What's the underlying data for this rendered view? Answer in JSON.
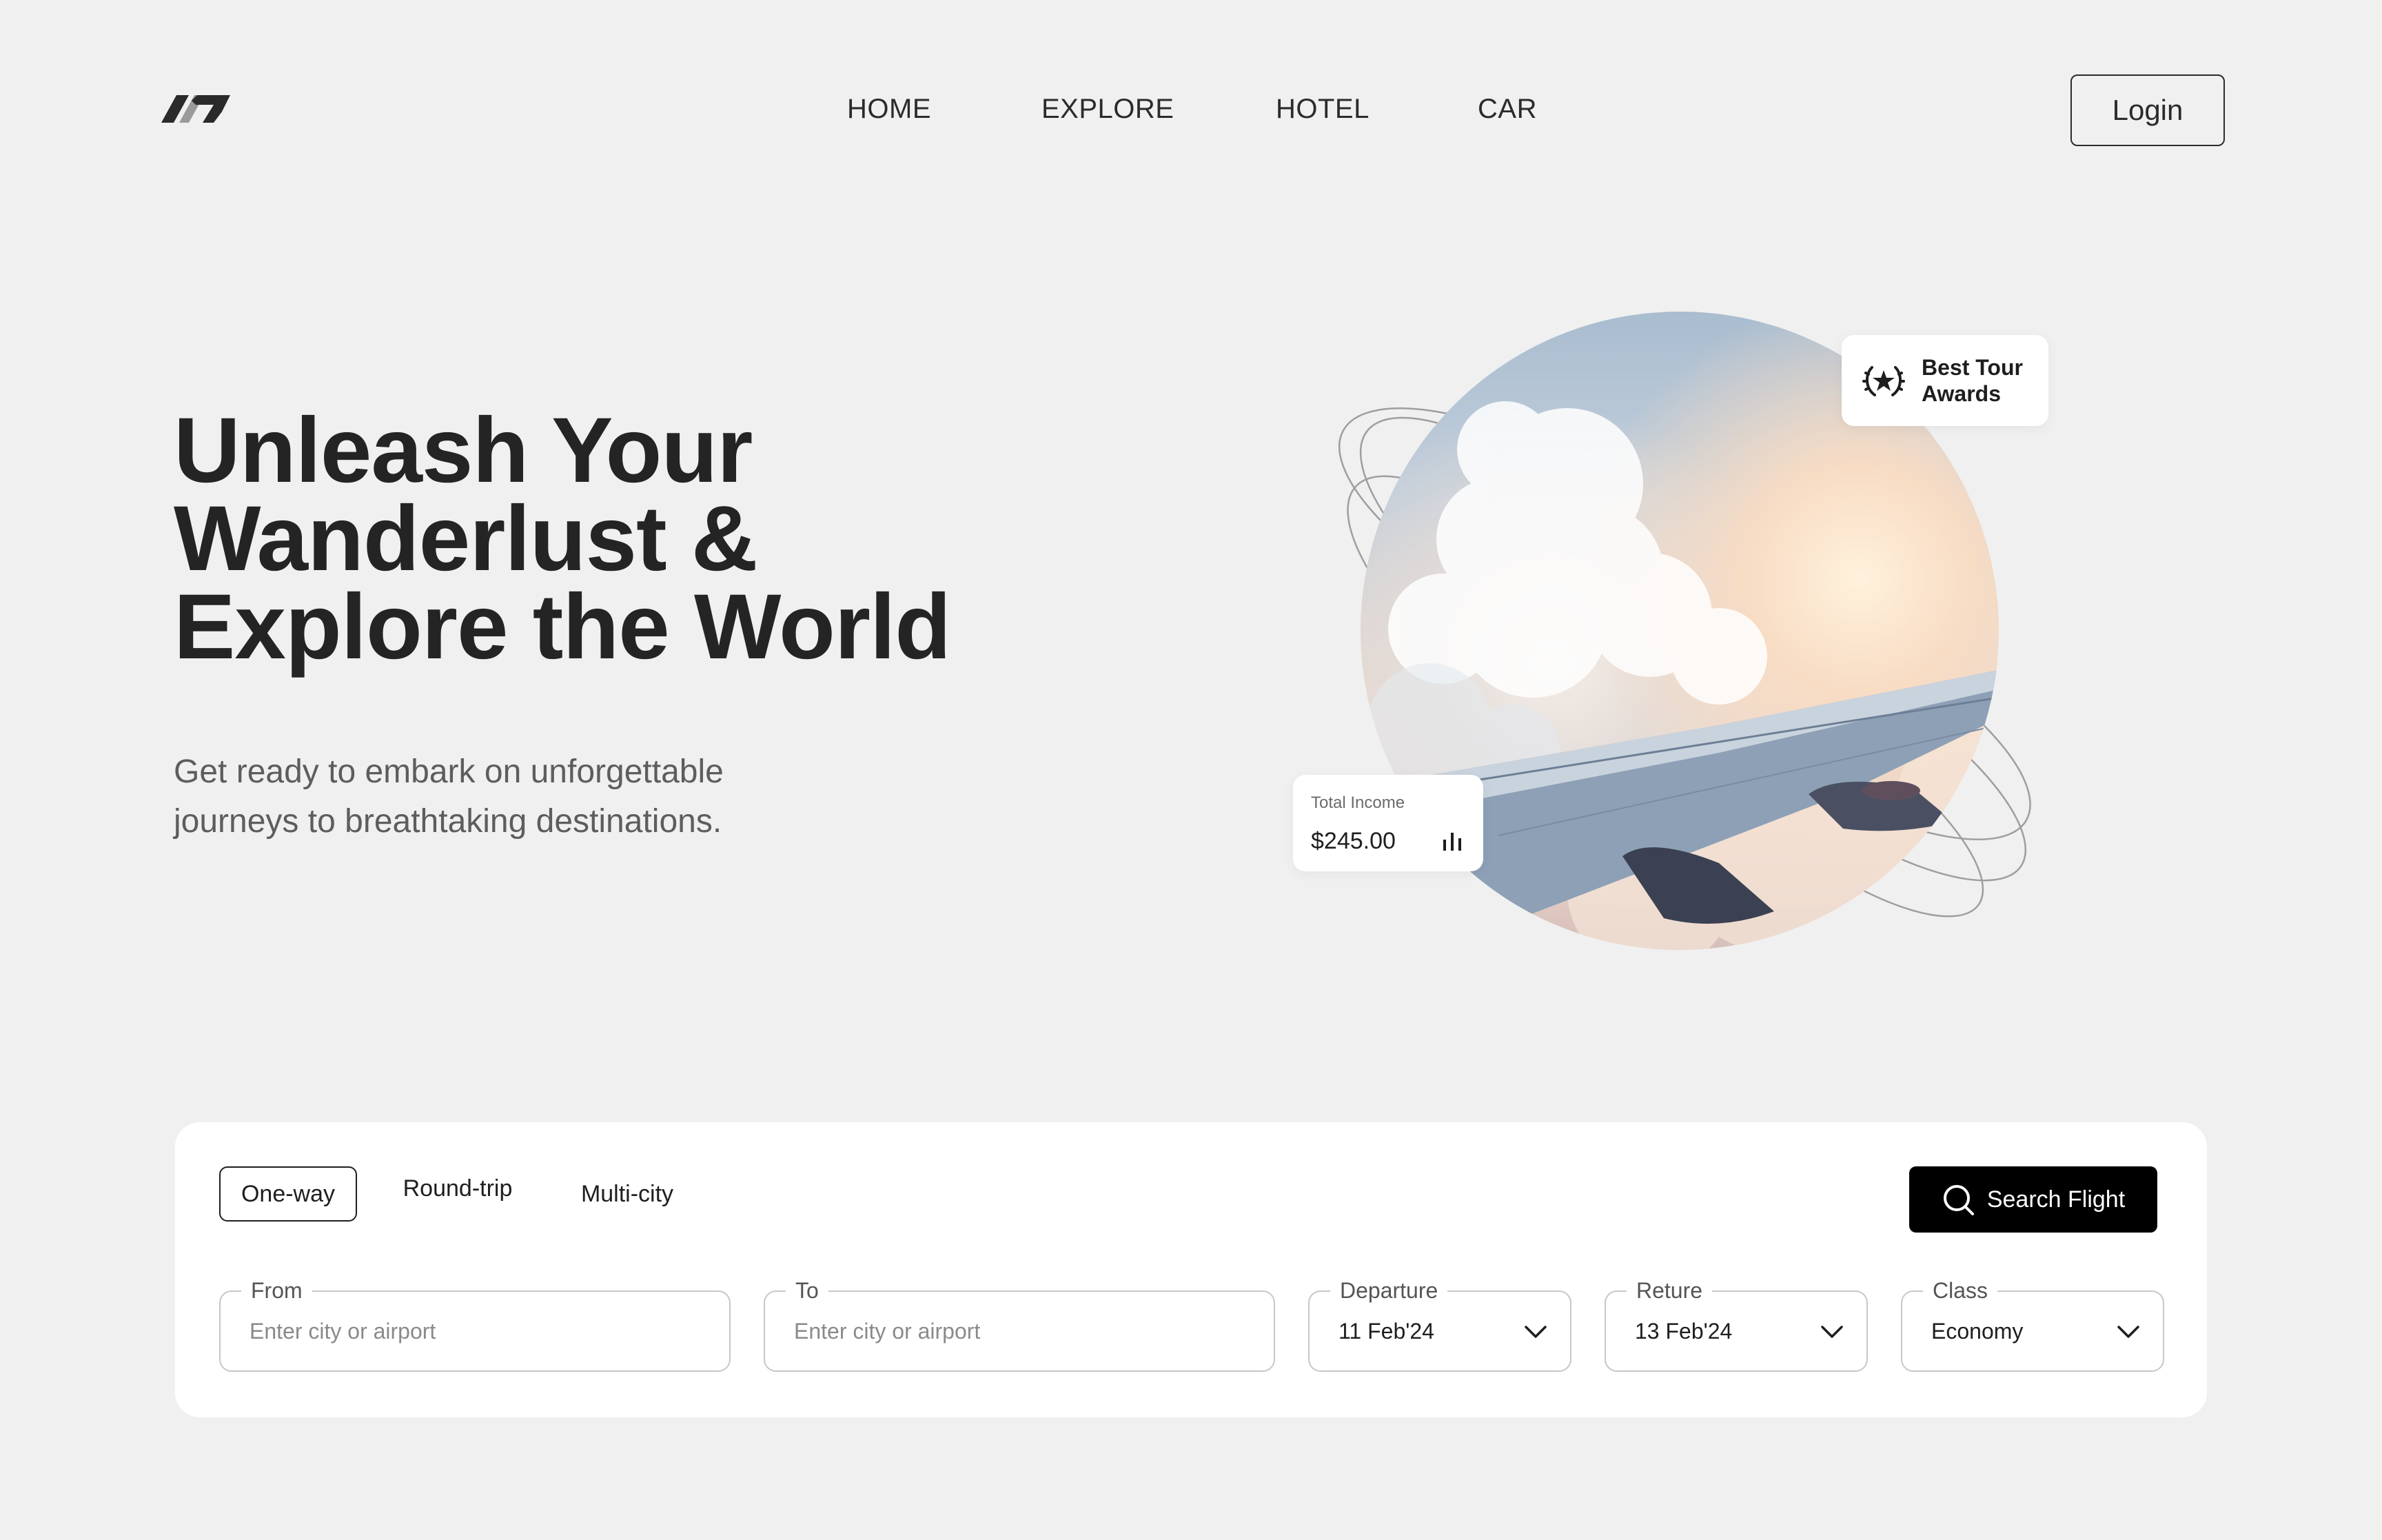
{
  "header": {
    "nav": [
      "HOME",
      "EXPLORE",
      "HOTEL",
      "CAR"
    ],
    "login_label": "Login"
  },
  "hero": {
    "title": "Unleash Your\nWanderlust &\nExplore the World",
    "subtitle": "Get ready to embark on unforgettable\njourneys to breathtaking destinations."
  },
  "badges": {
    "award_label": "Best Tour Awards",
    "income_label": "Total Income",
    "income_value": "$245.00"
  },
  "search": {
    "trip_types": [
      "One-way",
      "Round-trip",
      "Multi-city"
    ],
    "active_trip_type": "One-way",
    "search_label": "Search Flight",
    "from_label": "From",
    "from_placeholder": "Enter city or airport",
    "to_label": "To",
    "to_placeholder": "Enter city or airport",
    "departure_label": "Departure",
    "departure_value": "11 Feb'24",
    "return_label": "Reture",
    "return_value": "13 Feb'24",
    "class_label": "Class",
    "class_value": "Economy"
  },
  "icons": {
    "logo": "brand-logo-icon",
    "award": "laurel-star-icon",
    "income": "bar-chart-icon",
    "search": "search-icon",
    "dropdown": "chevron-down-icon"
  },
  "colors": {
    "background": "#f0f0f0",
    "text": "#1f1f1f",
    "button": "#000000",
    "panel": "#ffffff"
  }
}
